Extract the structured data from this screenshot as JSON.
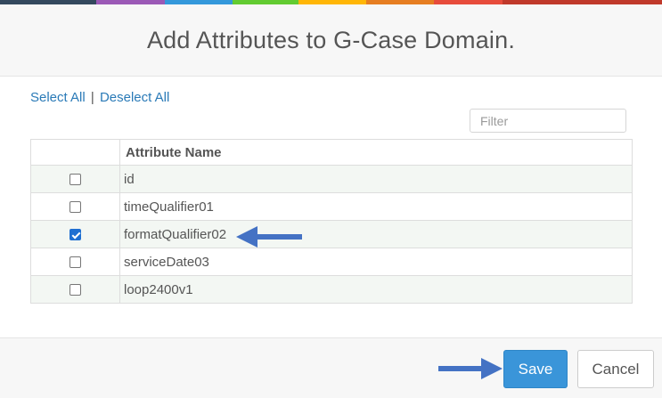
{
  "top_stripe_colors": [
    "#34495e",
    "#9b59b6",
    "#3498db",
    "#62cb31",
    "#ffb606",
    "#e67e22",
    "#e74c3c",
    "#c0392b"
  ],
  "dialog": {
    "title": "Add Attributes to G-Case Domain."
  },
  "selection": {
    "select_all_label": "Select All",
    "separator": "|",
    "deselect_all_label": "Deselect All"
  },
  "filter": {
    "value": "",
    "placeholder": "Filter"
  },
  "table": {
    "checkbox_column_header": "",
    "name_column_header": "Attribute Name",
    "rows": [
      {
        "name": "id",
        "checked": false
      },
      {
        "name": "timeQualifier01",
        "checked": false
      },
      {
        "name": "formatQualifier02",
        "checked": true
      },
      {
        "name": "serviceDate03",
        "checked": false
      },
      {
        "name": "loop2400v1",
        "checked": false
      }
    ]
  },
  "annotations": {
    "arrow_color": "#4472c4",
    "arrow_icon": "arrow-left-icon",
    "save_arrow_icon": "arrow-right-icon"
  },
  "footer": {
    "save_label": "Save",
    "cancel_label": "Cancel"
  }
}
